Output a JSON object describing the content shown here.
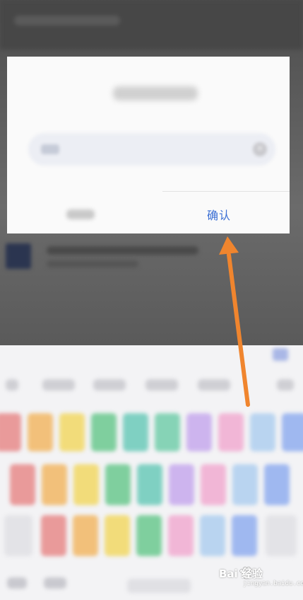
{
  "dialog": {
    "title": "",
    "input_value": "",
    "cancel_label": "",
    "confirm_label": "确认"
  },
  "icons": {
    "clear": "clear-circle-icon",
    "arrow": "annotation-arrow-icon"
  },
  "colors": {
    "confirm_text": "#3b6fd4",
    "arrow": "#f0852e",
    "dim_overlay": "#5f5f5f"
  },
  "watermark": {
    "brand": "Bai  经验",
    "url": "jingyan.baidu.com"
  }
}
